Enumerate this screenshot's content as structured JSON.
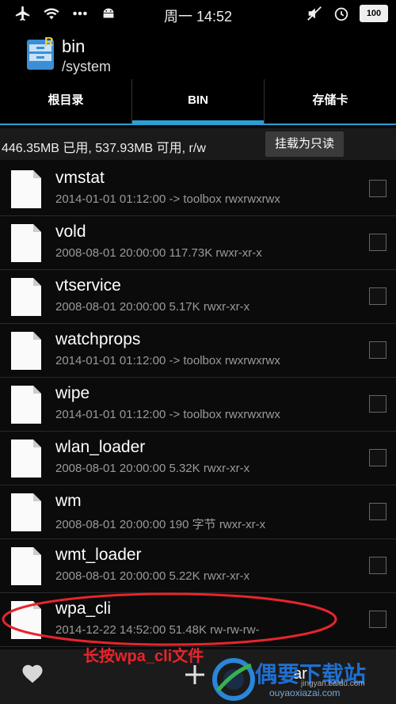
{
  "status_bar": {
    "time": "周一 14:52",
    "battery": "100",
    "left_icons": [
      "airplane-icon",
      "wifi-icon",
      "more-icon",
      "android-icon"
    ],
    "right_icons": [
      "mute-icon",
      "alarm-icon",
      "battery-icon"
    ]
  },
  "header": {
    "title": "bin",
    "path": "/system"
  },
  "tabs": [
    {
      "label": "根目录"
    },
    {
      "label": "BIN",
      "active": true
    },
    {
      "label": "存储卡"
    }
  ],
  "storage": {
    "info": "446.35MB 已用, 537.93MB 可用, r/w",
    "mount_button": "挂载为只读"
  },
  "files": [
    {
      "name": "vmstat",
      "meta": "2014-01-01 01:12:00  -> toolbox  rwxrwxrwx"
    },
    {
      "name": "vold",
      "meta": "2008-08-01 20:00:00  117.73K  rwxr-xr-x"
    },
    {
      "name": "vtservice",
      "meta": "2008-08-01 20:00:00  5.17K  rwxr-xr-x"
    },
    {
      "name": "watchprops",
      "meta": "2014-01-01 01:12:00  -> toolbox  rwxrwxrwx"
    },
    {
      "name": "wipe",
      "meta": "2014-01-01 01:12:00  -> toolbox  rwxrwxrwx"
    },
    {
      "name": "wlan_loader",
      "meta": "2008-08-01 20:00:00  5.32K  rwxr-xr-x"
    },
    {
      "name": "wm",
      "meta": "2008-08-01 20:00:00  190 字节  rwxr-xr-x"
    },
    {
      "name": "wmt_loader",
      "meta": "2008-08-01 20:00:00  5.22K  rwxr-xr-x"
    },
    {
      "name": "wpa_cli",
      "meta": "2014-12-22 14:52:00  51.48K  rw-rw-rw-"
    }
  ],
  "annotation": {
    "text": "长按wpa_cli文件",
    "color": "#e8242c"
  },
  "bottom_bar": {
    "partial_label": "ar",
    "watermark_text": "偶要下载站",
    "watermark_url": "ouyaoxiazai.com",
    "watermark_url2": "jingyan.baidu.com"
  },
  "colors": {
    "accent": "#2e9ed6",
    "background": "#0b0b0b"
  }
}
